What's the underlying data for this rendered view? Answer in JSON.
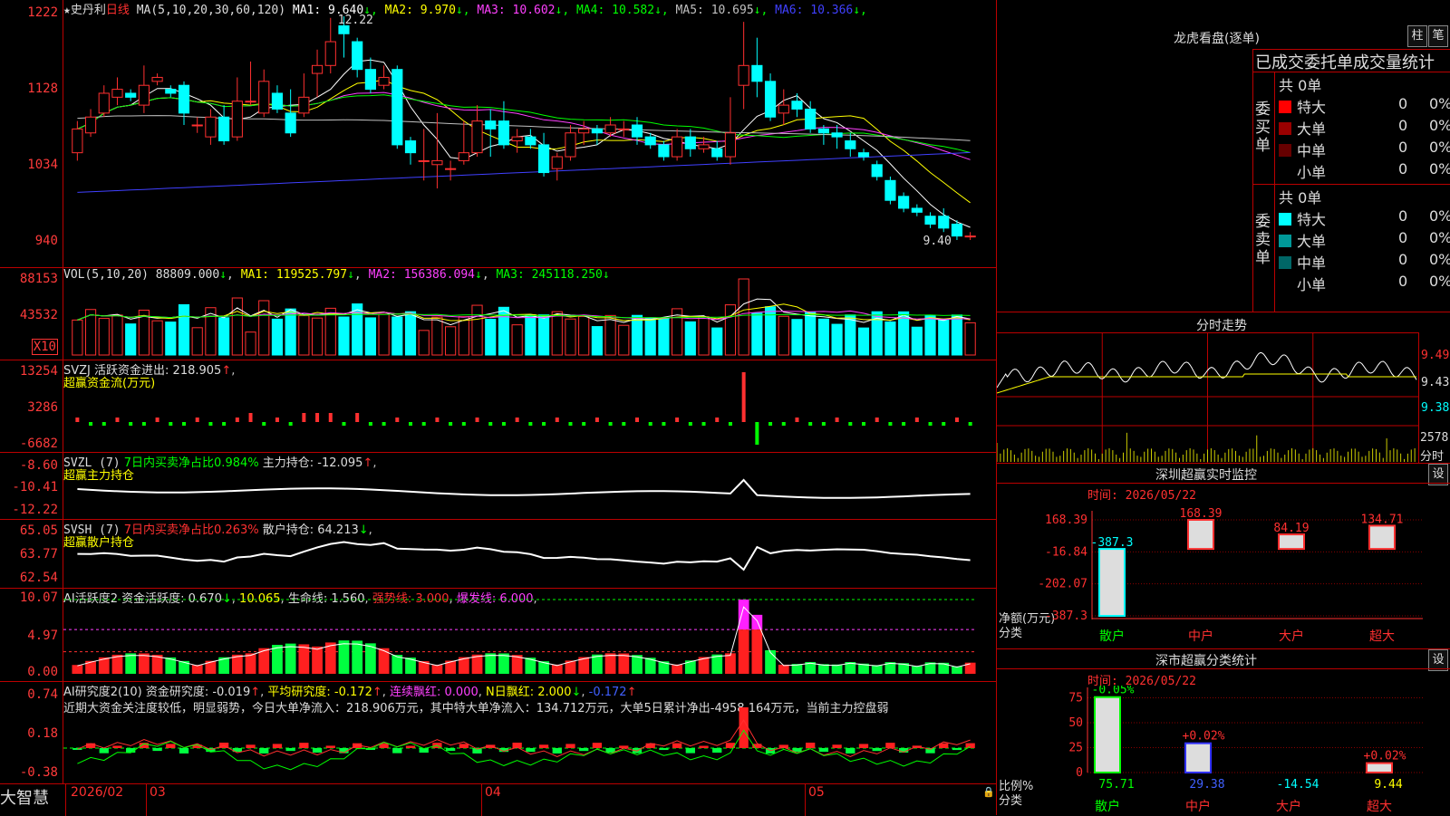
{
  "main": {
    "stock_name": "史丹利",
    "period": "日线",
    "ma_label": "MA(5,10,20,30,60,120)",
    "ma_values": [
      {
        "name": "MA1",
        "value": "9.640",
        "arrow": "↓",
        "color": "#ffffff"
      },
      {
        "name": "MA2",
        "value": "9.970",
        "arrow": "↓",
        "color": "#ffff00"
      },
      {
        "name": "MA3",
        "value": "10.602",
        "arrow": "↓",
        "color": "#ff40ff"
      },
      {
        "name": "MA4",
        "value": "10.582",
        "arrow": "↓",
        "color": "#00ff00"
      },
      {
        "name": "MA5",
        "value": "10.695",
        "arrow": "↓",
        "color": "#c0c0c0"
      },
      {
        "name": "MA6",
        "value": "10.366",
        "arrow": "↓",
        "color": "#4040ff"
      }
    ],
    "y_ticks": [
      "1222",
      "1128",
      "1034",
      "940"
    ],
    "high_label": "12.22",
    "low_label": "9.40"
  },
  "vol": {
    "label": "VOL(5,10,20)",
    "value": "88809.000",
    "ma1": "MA1: 119525.797",
    "ma2": "MA2: 156386.094",
    "ma3": "MA3: 245118.250",
    "y_ticks": [
      "88153",
      "43532"
    ],
    "unit": "X10"
  },
  "svzj": {
    "label": "SVZJ",
    "text": "活跃资金进出: 218.905",
    "subtitle": "超赢资金流(万元)",
    "y_ticks": [
      "13254",
      "3286",
      "-6682"
    ]
  },
  "svzl": {
    "label": "SVZL (7)",
    "text_a": "7日内买卖净占比0.984%",
    "text_b": "主力持仓: -12.095",
    "subtitle": "超赢主力持仓",
    "y_ticks": [
      "-8.60",
      "-10.41",
      "-12.22"
    ]
  },
  "svsh": {
    "label": "SVSH (7)",
    "text_a": "7日内买卖净占比0.263%",
    "text_b": "散户持仓: 64.213",
    "subtitle": "超赢散户持仓",
    "y_ticks": [
      "65.05",
      "63.77",
      "62.54"
    ]
  },
  "ai_active": {
    "label": "AI活跃度2",
    "t1": "资金活跃度: 0.670",
    "t2": "10.065",
    "t3": "生命线: 1.560",
    "t4": "强势线: 3.000",
    "t5": "爆发线: 6.000",
    "y_ticks": [
      "10.07",
      "4.97",
      "0.00"
    ]
  },
  "ai_research": {
    "label": "AI研究度2(10)",
    "t1": "资金研究度: -0.019",
    "t2": "平均研究度: -0.172",
    "t3": "连续飘红: 0.000",
    "t4": "N日飘红: 2.000",
    "t5": "-0.172",
    "summary": "近期大资金关注度较低，明显弱势，今日大单净流入：218.906万元，其中特大单净流入：134.712万元，大单5日累计净出-4958.164万元，当前主力控盘弱",
    "y_ticks": [
      "0.74",
      "0.18",
      "-0.38"
    ]
  },
  "bottom": {
    "brand": "大智慧",
    "dates": [
      "2026/02",
      "03",
      "04",
      "05"
    ]
  },
  "right": {
    "dragon_title": "龙虎看盘(逐单)",
    "btn_zhu": "柱",
    "btn_bi": "笔",
    "stat_title": "已成交委托单成交量统计",
    "buy_label": "委买单",
    "sell_label": "委卖单",
    "buy_total": "共 0单",
    "sell_total": "共 0单",
    "buy_rows": [
      {
        "name": "特大",
        "count": "0",
        "pct": "0%",
        "color": "#ff0000"
      },
      {
        "name": "大单",
        "count": "0",
        "pct": "0%",
        "color": "#990000"
      },
      {
        "name": "中单",
        "count": "0",
        "pct": "0%",
        "color": "#660000"
      },
      {
        "name": "小单",
        "count": "0",
        "pct": "0%",
        "color": "#000000"
      }
    ],
    "sell_rows": [
      {
        "name": "特大",
        "count": "0",
        "pct": "0%",
        "color": "#00ffff"
      },
      {
        "name": "大单",
        "count": "0",
        "pct": "0%",
        "color": "#009999"
      },
      {
        "name": "中单",
        "count": "0",
        "pct": "0%",
        "color": "#006666"
      },
      {
        "name": "小单",
        "count": "0",
        "pct": "0%",
        "color": "#000000"
      }
    ],
    "tick_title": "分时走势",
    "tick_prices": [
      "9.49",
      "9.43",
      "9.38"
    ],
    "tick_vol": "2578",
    "tick_vol_unit": "分时",
    "sz_monitor": {
      "title": "深圳超赢实时监控",
      "btn": "设",
      "time": "时间: 2026/05/22",
      "y_ticks": [
        "168.39",
        "-16.84",
        "-202.07",
        "-387.3"
      ],
      "y_caption": "净额(万元)",
      "x_caption": "分类",
      "cats": [
        "散户",
        "中户",
        "大户",
        "超大"
      ],
      "values": [
        -387.3,
        168.39,
        84.19,
        134.71
      ],
      "labels": [
        "-387.3",
        "168.39",
        "84.19",
        "134.71"
      ]
    },
    "sz_class": {
      "title": "深市超赢分类统计",
      "btn": "设",
      "time": "时间: 2026/05/22",
      "y_ticks": [
        "75",
        "50",
        "25",
        "0"
      ],
      "y_caption": "比例%",
      "x_caption": "分类",
      "cats": [
        "散户",
        "中户",
        "大户",
        "超大"
      ],
      "bar_values": [
        75.71,
        29.38,
        0,
        9.44
      ],
      "bottom_labels": [
        "75.71",
        "29.38",
        "-14.54",
        "9.44"
      ],
      "top_labels": [
        "-0.05%",
        "+0.02%",
        "",
        "+0.02%"
      ]
    }
  },
  "chart_data": {
    "type": "candlestick",
    "title": "史丹利 日线",
    "ylim": [
      9.4,
      12.22
    ],
    "candles": [
      [
        10.5,
        10.8,
        10.4,
        10.9
      ],
      [
        10.75,
        10.95,
        10.7,
        11.05
      ],
      [
        11.0,
        11.25,
        10.95,
        11.35
      ],
      [
        11.2,
        11.3,
        11.1,
        11.45
      ],
      [
        11.25,
        11.2,
        11.15,
        11.3
      ],
      [
        11.1,
        11.35,
        11.0,
        11.6
      ],
      [
        11.4,
        11.45,
        11.35,
        11.5
      ],
      [
        11.3,
        11.25,
        11.2,
        11.35
      ],
      [
        11.35,
        11.0,
        10.85,
        11.4
      ],
      [
        10.85,
        10.85,
        10.75,
        10.95
      ],
      [
        10.7,
        10.95,
        10.6,
        11.05
      ],
      [
        10.95,
        10.65,
        10.6,
        11.1
      ],
      [
        10.7,
        11.15,
        10.65,
        11.45
      ],
      [
        11.15,
        11.15,
        11.1,
        11.65
      ],
      [
        11.0,
        11.4,
        10.95,
        11.55
      ],
      [
        11.25,
        11.05,
        11.0,
        11.35
      ],
      [
        11.0,
        10.75,
        10.7,
        11.3
      ],
      [
        11.0,
        11.2,
        10.95,
        11.5
      ],
      [
        11.5,
        11.6,
        11.2,
        11.8
      ],
      [
        11.6,
        11.9,
        11.5,
        12.2
      ],
      [
        12.1,
        12.0,
        11.7,
        12.22
      ],
      [
        11.9,
        11.55,
        11.45,
        11.95
      ],
      [
        11.55,
        11.3,
        11.25,
        11.7
      ],
      [
        11.35,
        11.45,
        11.3,
        11.6
      ],
      [
        11.55,
        10.6,
        10.55,
        11.6
      ],
      [
        10.65,
        10.5,
        10.35,
        10.7
      ],
      [
        10.4,
        10.4,
        10.15,
        10.8
      ],
      [
        10.35,
        10.4,
        10.05,
        11.0
      ],
      [
        10.3,
        10.3,
        10.15,
        10.4
      ],
      [
        10.4,
        10.5,
        10.35,
        10.9
      ],
      [
        10.5,
        10.9,
        10.45,
        11.1
      ],
      [
        10.9,
        10.8,
        10.45,
        11.05
      ],
      [
        10.9,
        10.6,
        10.55,
        11.15
      ],
      [
        10.65,
        10.7,
        10.5,
        10.8
      ],
      [
        10.7,
        10.6,
        10.55,
        10.8
      ],
      [
        10.6,
        10.25,
        10.2,
        10.75
      ],
      [
        10.3,
        10.45,
        10.15,
        10.5
      ],
      [
        10.45,
        10.75,
        10.4,
        10.85
      ],
      [
        10.75,
        10.8,
        10.6,
        10.9
      ],
      [
        10.8,
        10.75,
        10.6,
        10.85
      ],
      [
        10.75,
        10.85,
        10.7,
        10.95
      ],
      [
        10.8,
        10.8,
        10.7,
        10.9
      ],
      [
        10.85,
        10.7,
        10.6,
        10.95
      ],
      [
        10.7,
        10.6,
        10.55,
        10.75
      ],
      [
        10.6,
        10.45,
        10.4,
        10.65
      ],
      [
        10.45,
        10.7,
        10.4,
        10.8
      ],
      [
        10.7,
        10.55,
        10.45,
        10.8
      ],
      [
        10.55,
        10.6,
        10.5,
        10.7
      ],
      [
        10.55,
        10.45,
        10.4,
        10.65
      ],
      [
        10.45,
        10.75,
        10.35,
        11.2
      ],
      [
        11.35,
        11.6,
        11.05,
        12.15
      ],
      [
        11.6,
        11.4,
        11.2,
        11.95
      ],
      [
        11.4,
        10.95,
        10.9,
        11.5
      ],
      [
        11.0,
        11.1,
        10.85,
        11.3
      ],
      [
        11.15,
        11.05,
        10.95,
        11.25
      ],
      [
        11.05,
        10.8,
        10.75,
        11.15
      ],
      [
        10.8,
        10.75,
        10.6,
        10.85
      ],
      [
        10.75,
        10.7,
        10.55,
        10.85
      ],
      [
        10.65,
        10.55,
        10.45,
        10.75
      ],
      [
        10.5,
        10.45,
        10.4,
        10.55
      ],
      [
        10.35,
        10.2,
        10.15,
        10.4
      ],
      [
        10.15,
        9.9,
        9.85,
        10.2
      ],
      [
        9.95,
        9.8,
        9.75,
        10.0
      ],
      [
        9.8,
        9.75,
        9.7,
        9.85
      ],
      [
        9.7,
        9.6,
        9.55,
        9.75
      ],
      [
        9.7,
        9.55,
        9.5,
        9.8
      ],
      [
        9.6,
        9.45,
        9.4,
        9.65
      ],
      [
        9.45,
        9.45,
        9.4,
        9.5
      ]
    ]
  }
}
